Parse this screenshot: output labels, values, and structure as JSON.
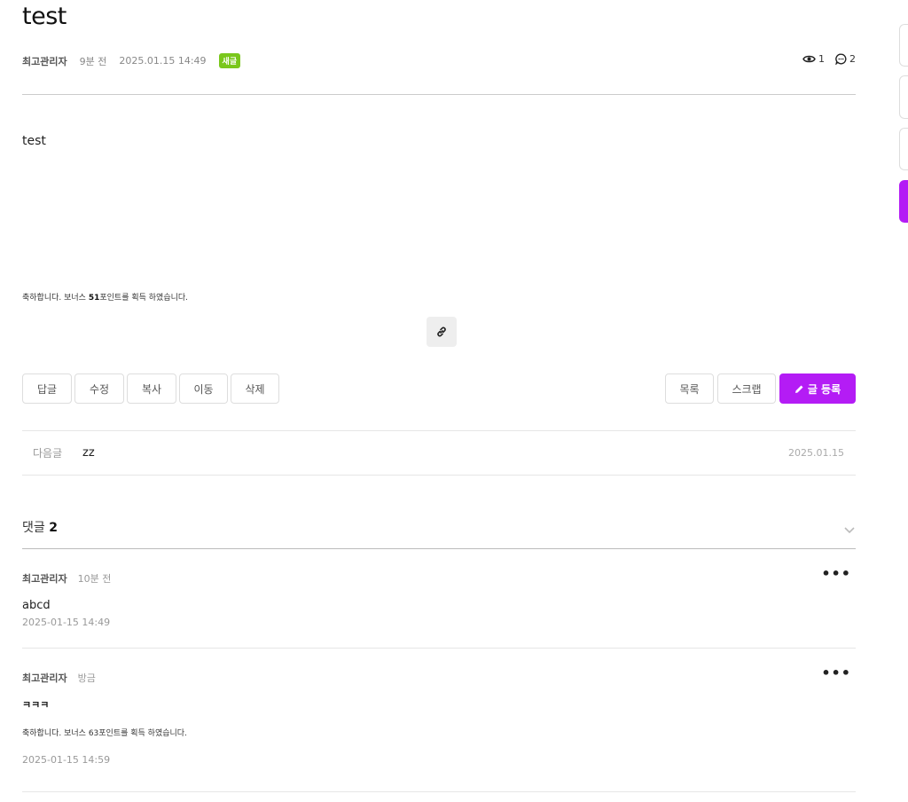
{
  "post": {
    "title": "test",
    "author": "최고관리자",
    "ago": "9분 전",
    "date": "2025.01.15 14:49",
    "badge": "새글",
    "views": "1",
    "comments": "2",
    "body": "test",
    "bonus_pre": "축하합니다. 보너스 ",
    "bonus_points": "51",
    "bonus_post": "포인트를 획득 하였습니다."
  },
  "actions_left": [
    "답글",
    "수정",
    "복사",
    "이동",
    "삭제"
  ],
  "actions_right": {
    "list": "목록",
    "scrap": "스크랩",
    "write": "글 등록"
  },
  "next": {
    "label": "다음글",
    "title": "zz",
    "date": "2025.01.15"
  },
  "comments_section": {
    "label": "댓글",
    "count": "2"
  },
  "comments": [
    {
      "author": "최고관리자",
      "ago": "10분 전",
      "text": "abcd",
      "stamp": "2025-01-15 14:49"
    },
    {
      "author": "최고관리자",
      "ago": "방금",
      "text": "ㅋㅋㅋ",
      "bonus_pre": "축하합니다. 보너스 ",
      "bonus_points": "63",
      "bonus_post": "포인트를 획득 하였습니다.",
      "stamp": "2025-01-15 14:59"
    }
  ],
  "colors": {
    "accent": "#b41cf5",
    "new_badge": "#7ac71c"
  },
  "icons": {
    "views": "eye-icon",
    "comments": "comment-icon",
    "link": "link-icon",
    "write": "pencil-icon",
    "toggle": "chevron-down-icon",
    "more": "more-icon"
  }
}
